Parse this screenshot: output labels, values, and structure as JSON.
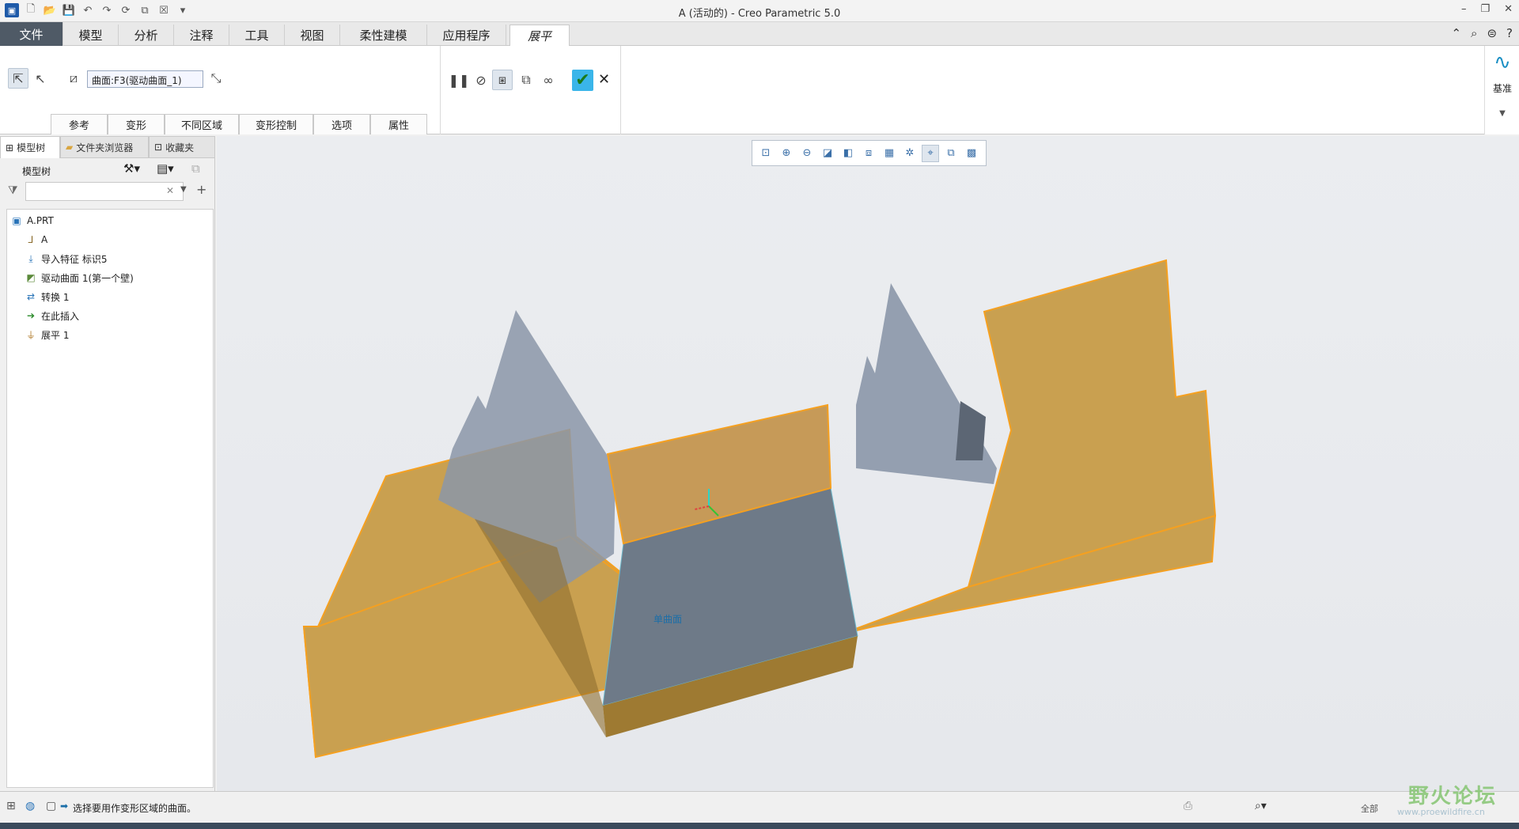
{
  "window": {
    "title": "A (活动的) - Creo Parametric 5.0"
  },
  "menu": {
    "tabs": [
      "文件",
      "模型",
      "分析",
      "注释",
      "工具",
      "视图",
      "柔性建模",
      "应用程序",
      "展平"
    ]
  },
  "ribbon": {
    "surface_field": "曲面:F3(驱动曲面_1)",
    "subtabs": [
      "参考",
      "变形",
      "不同区域",
      "变形控制",
      "选项",
      "属性"
    ],
    "datum_label": "基准"
  },
  "panel": {
    "tabs": [
      "模型树",
      "文件夹浏览器",
      "收藏夹"
    ],
    "tree_header": "模型树",
    "tree_items": [
      {
        "label": "A.PRT",
        "icon": "part-icon"
      },
      {
        "label": "A",
        "icon": "coordinate-system-icon"
      },
      {
        "label": "导入特征 标识5",
        "icon": "import-feature-icon"
      },
      {
        "label": "驱动曲面 1(第一个壁)",
        "icon": "driving-surface-icon"
      },
      {
        "label": "转换 1",
        "icon": "transform-icon"
      },
      {
        "label": "在此插入",
        "icon": "insert-here-arrow-icon"
      },
      {
        "label": "展平 1",
        "icon": "flatten-icon"
      }
    ]
  },
  "viewport": {
    "surface_label": "单曲面",
    "colors": {
      "flattened": "#c9a050",
      "flattened_edge": "#f5a020",
      "part_gray": "#8b97a8",
      "part_dark": "#6e7a88",
      "base_dark": "#9e7a32"
    }
  },
  "status": {
    "message": "选择要用作变形区域的曲面。",
    "filter_label": "全部"
  },
  "watermark": {
    "brand": "野火论坛",
    "url": "www.proewildfire.cn"
  }
}
